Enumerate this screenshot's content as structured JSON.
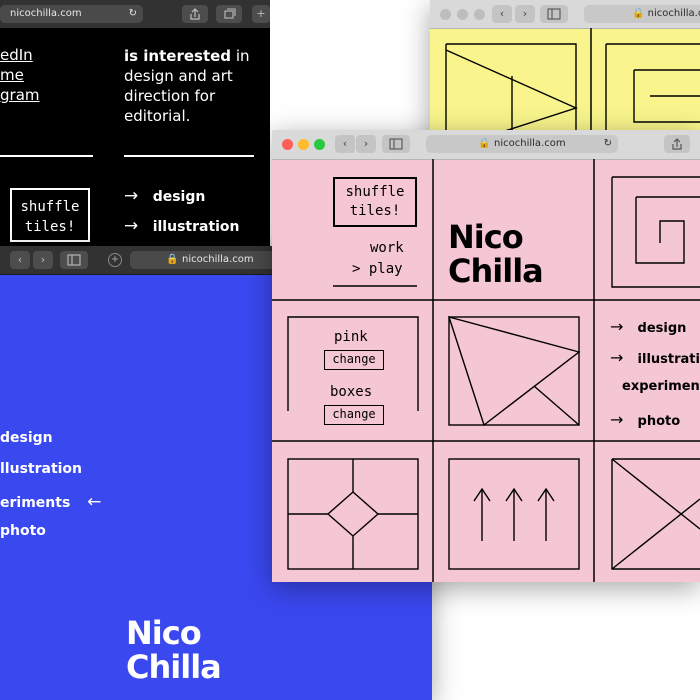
{
  "back_window": {
    "url": "nicochilla.com",
    "links": [
      "edIn",
      "me",
      "gram"
    ],
    "interest_bold": "is interested",
    "interest_rest": [
      "in",
      "design and art",
      "direction for",
      "editorial."
    ],
    "shuffle_line1": "shuffle",
    "shuffle_line2": "tiles!",
    "arrow": "→",
    "menu": [
      "design",
      "illustration"
    ]
  },
  "blue_window": {
    "url": "nicochilla.com",
    "menu": [
      "design",
      "llustration",
      "eriments",
      "photo"
    ],
    "active_arrow": "←",
    "logo_line1": "Nico",
    "logo_line2": "Chilla"
  },
  "yellow_window": {
    "url": "nicochilla.c"
  },
  "pink_window": {
    "url": "nicochilla.com",
    "shuffle_line1": "shuffle",
    "shuffle_line2": "tiles!",
    "work": "work",
    "play": "play",
    "play_arrow": ">",
    "logo_line1": "Nico",
    "logo_line2": "Chilla",
    "pink_label": "pink",
    "boxes_label": "boxes",
    "change_label": "change",
    "arrow": "→",
    "menu": [
      "design",
      "illustratio",
      "experiment",
      "photo"
    ]
  },
  "colors": {
    "pink": "#f5c6d3",
    "blue": "#3a48f0",
    "yellow": "#f9f58c",
    "black": "#000000"
  }
}
